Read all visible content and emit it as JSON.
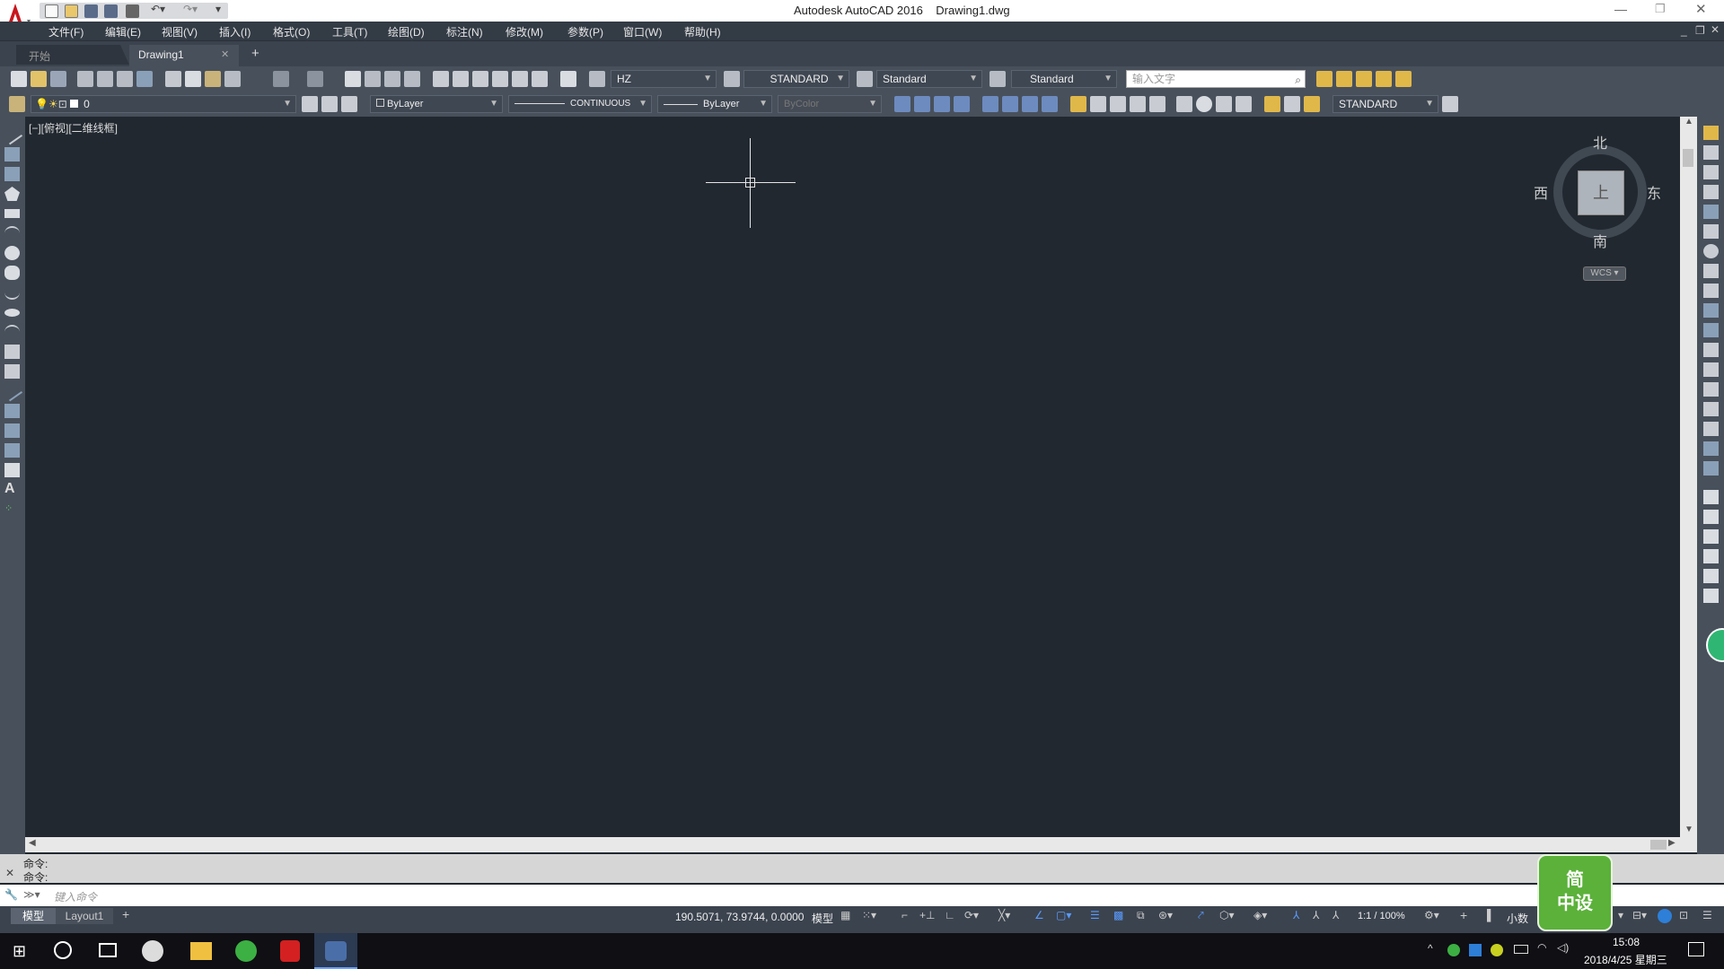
{
  "title": {
    "app": "Autodesk AutoCAD 2016",
    "file": "Drawing1.dwg"
  },
  "menu": [
    "文件(F)",
    "编辑(E)",
    "视图(V)",
    "插入(I)",
    "格式(O)",
    "工具(T)",
    "绘图(D)",
    "标注(N)",
    "修改(M)",
    "参数(P)",
    "窗口(W)",
    "帮助(H)"
  ],
  "tabs": {
    "start": "开始",
    "doc": "Drawing1",
    "add": "+"
  },
  "toolbar1": {
    "text_style": "HZ",
    "dim_style": "STANDARD",
    "table_style": "Standard",
    "mleader_style": "Standard",
    "search_placeholder": "输入文字"
  },
  "toolbar2": {
    "layer": "0",
    "color": "ByLayer",
    "linetype": "CONTINUOUS",
    "lineweight": "ByLayer",
    "plotstyle": "ByColor",
    "visual": "STANDARD"
  },
  "viewport": {
    "label": "[−][俯视][二维线框]"
  },
  "viewcube": {
    "north": "北",
    "south": "南",
    "east": "东",
    "west": "西",
    "top": "上",
    "wcs": "WCS ▾"
  },
  "command": {
    "line1": "命令:",
    "line2": "命令:",
    "placeholder": "键入命令"
  },
  "layout_tabs": {
    "model": "模型",
    "layout1": "Layout1",
    "add": "+"
  },
  "status": {
    "coords": "190.5071, 73.9744, 0.0000",
    "mode": "模型",
    "scale": "1:1 / 100%",
    "units": "小数"
  },
  "taskbar": {
    "time": "15:08",
    "date": "2018/4/25 星期三"
  },
  "badge": {
    "line1": "简",
    "line2": "中设"
  },
  "colors": {
    "canvas": "#212830",
    "toolbar": "#48505b",
    "accent": "#c8171e"
  }
}
